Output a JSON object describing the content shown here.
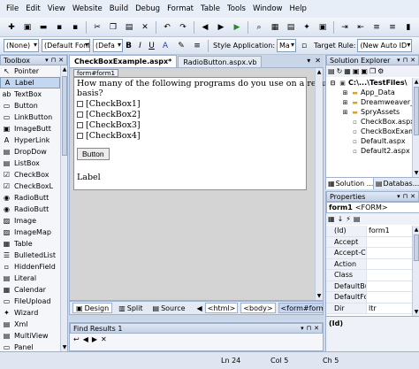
{
  "menu": [
    "File",
    "Edit",
    "View",
    "Website",
    "Build",
    "Debug",
    "Format",
    "Table",
    "Tools",
    "Window",
    "Help"
  ],
  "toolbar2": {
    "block_format": "(None)",
    "font_name": "(Default Font",
    "font_size": "(Defa",
    "bold": "B",
    "italic": "I",
    "underline": "U",
    "style_app_label": "Style Application:",
    "style_app_value": "Ma",
    "target_rule_label": "Target Rule:",
    "target_rule_value": "(New Auto ID"
  },
  "toolbox": {
    "title": "Toolbox",
    "items": [
      {
        "label": "Pointer",
        "icon": "pointer-icon",
        "glyph": "↖"
      },
      {
        "label": "Label",
        "icon": "label-icon",
        "glyph": "A"
      },
      {
        "label": "TextBox",
        "icon": "textbox-icon",
        "glyph": "ab"
      },
      {
        "label": "Button",
        "icon": "button-icon",
        "glyph": "▭"
      },
      {
        "label": "LinkButton",
        "icon": "linkbutton-icon",
        "glyph": "▭"
      },
      {
        "label": "ImageButt",
        "icon": "imagebutton-icon",
        "glyph": "▣"
      },
      {
        "label": "HyperLink",
        "icon": "hyperlink-icon",
        "glyph": "A"
      },
      {
        "label": "DropDow",
        "icon": "dropdown-icon",
        "glyph": "▤"
      },
      {
        "label": "ListBox",
        "icon": "listbox-icon",
        "glyph": "▤"
      },
      {
        "label": "CheckBox",
        "icon": "checkbox-icon",
        "glyph": "☑"
      },
      {
        "label": "CheckBoxL",
        "icon": "checkboxlist-icon",
        "glyph": "☑"
      },
      {
        "label": "RadioButt",
        "icon": "radiobutton-icon",
        "glyph": "◉"
      },
      {
        "label": "RadioButt",
        "icon": "radiobuttonlist-icon",
        "glyph": "◉"
      },
      {
        "label": "Image",
        "icon": "image-icon",
        "glyph": "▨"
      },
      {
        "label": "ImageMap",
        "icon": "imagemap-icon",
        "glyph": "▨"
      },
      {
        "label": "Table",
        "icon": "table-icon",
        "glyph": "▦"
      },
      {
        "label": "BulletedList",
        "icon": "bulletedlist-icon",
        "glyph": "☰"
      },
      {
        "label": "HiddenField",
        "icon": "hiddenfield-icon",
        "glyph": "▫"
      },
      {
        "label": "Literal",
        "icon": "literal-icon",
        "glyph": "▤"
      },
      {
        "label": "Calendar",
        "icon": "calendar-icon",
        "glyph": "▦"
      },
      {
        "label": "FileUpload",
        "icon": "fileupload-icon",
        "glyph": "▭"
      },
      {
        "label": "Wizard",
        "icon": "wizard-icon",
        "glyph": "✦"
      },
      {
        "label": "Xml",
        "icon": "xml-icon",
        "glyph": "▤"
      },
      {
        "label": "MultiView",
        "icon": "multiview-icon",
        "glyph": "▤"
      },
      {
        "label": "Panel",
        "icon": "panel-icon",
        "glyph": "▭"
      }
    ]
  },
  "document": {
    "tabs": [
      "CheckBoxExample.aspx*",
      "RadioButton.aspx.vb"
    ],
    "form_tag": "form#form1",
    "question_line1": "How many of the following programs do you use on a regular",
    "question_line2": "basis?",
    "checkboxes": [
      "[CheckBox1]",
      "[CheckBox2]",
      "[CheckBox3]",
      "[CheckBox4]"
    ],
    "button_label": "Button",
    "label_text": "Label"
  },
  "viewbar": {
    "design": "Design",
    "split": "Split",
    "source": "Source",
    "crumbs": [
      "<html>",
      "<body>",
      "<form#form1>"
    ]
  },
  "find_results": {
    "title": "Find Results 1"
  },
  "solution_explorer": {
    "title": "Solution Explorer",
    "nodes": [
      {
        "label": "C:\\...\\TestFiles\\",
        "indent": 0,
        "icon": "project-icon",
        "glyph": "▣",
        "bold": true
      },
      {
        "label": "App_Data",
        "indent": 1,
        "icon": "folder-icon",
        "glyph": "▬"
      },
      {
        "label": "Dreamweaver_DB",
        "indent": 1,
        "icon": "folder-icon",
        "glyph": "▬"
      },
      {
        "label": "SpryAssets",
        "indent": 1,
        "icon": "folder-icon",
        "glyph": "▬"
      },
      {
        "label": "CheckBox.aspx",
        "indent": 1,
        "icon": "file-icon",
        "glyph": "▫"
      },
      {
        "label": "CheckBoxExample",
        "indent": 1,
        "icon": "file-icon",
        "glyph": "▫"
      },
      {
        "label": "Default.aspx",
        "indent": 1,
        "icon": "file-icon",
        "glyph": "▫"
      },
      {
        "label": "Default2.aspx",
        "indent": 1,
        "icon": "file-icon",
        "glyph": "▫"
      }
    ],
    "tabs": [
      "Solution ...",
      "Databas..."
    ]
  },
  "properties": {
    "title": "Properties",
    "object_name": "form1",
    "object_type": "<FORM>",
    "rows": [
      {
        "name": "(Id)",
        "value": "form1"
      },
      {
        "name": "Accept",
        "value": ""
      },
      {
        "name": "Accept-Ch",
        "value": ""
      },
      {
        "name": "Action",
        "value": ""
      },
      {
        "name": "Class",
        "value": ""
      },
      {
        "name": "DefaultBut",
        "value": ""
      },
      {
        "name": "DefaultFoc",
        "value": ""
      },
      {
        "name": "Dir",
        "value": "ltr"
      }
    ],
    "description_title": "(Id)"
  },
  "status": {
    "line": "Ln 24",
    "col": "Col 5",
    "ch": "Ch 5"
  },
  "colors": {
    "panel_border": "#9eb0cc",
    "selection": "#c5d6f0",
    "background": "#cfdcee"
  }
}
